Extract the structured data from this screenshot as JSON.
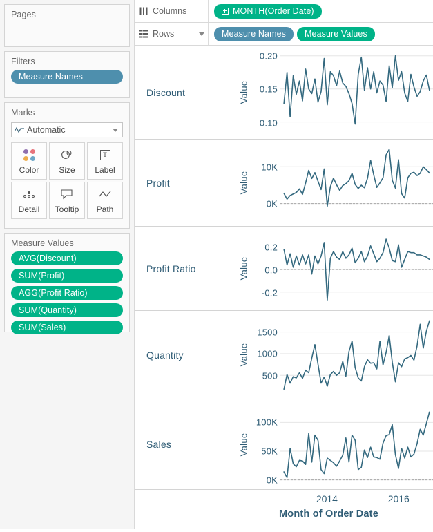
{
  "colors": {
    "pill_blue": "#4e8fad",
    "pill_green": "#00b388",
    "line": "#34697f",
    "text_blue": "#2f5c75",
    "panel_bg": "#f5f5f5",
    "card_bg": "#fafafa"
  },
  "left_panel": {
    "pages": {
      "title": "Pages"
    },
    "filters": {
      "title": "Filters",
      "pills": [
        {
          "label": "Measure Names",
          "color": "blue"
        }
      ]
    },
    "marks": {
      "title": "Marks",
      "mark_type": "Automatic",
      "mark_type_icon": "line-chart-icon",
      "buttons": [
        {
          "label": "Color",
          "icon": "color-dots-icon"
        },
        {
          "label": "Size",
          "icon": "size-icon"
        },
        {
          "label": "Label",
          "icon": "label-text-icon"
        },
        {
          "label": "Detail",
          "icon": "detail-dots-icon"
        },
        {
          "label": "Tooltip",
          "icon": "tooltip-icon"
        },
        {
          "label": "Path",
          "icon": "path-line-icon"
        }
      ]
    },
    "measure_values": {
      "title": "Measure Values",
      "pills": [
        {
          "label": "AVG(Discount)"
        },
        {
          "label": "SUM(Profit)"
        },
        {
          "label": "AGG(Profit Ratio)"
        },
        {
          "label": "SUM(Quantity)"
        },
        {
          "label": "SUM(Sales)"
        }
      ]
    }
  },
  "shelves": {
    "columns": {
      "label": "Columns",
      "icon": "columns-icon",
      "pills": [
        {
          "label": "MONTH(Order Date)",
          "color": "green",
          "has_plus": true
        }
      ]
    },
    "rows": {
      "label": "Rows",
      "icon": "rows-icon",
      "has_caret": true,
      "pills": [
        {
          "label": "Measure Names",
          "color": "blue",
          "has_plus": false
        },
        {
          "label": "Measure Values",
          "color": "green",
          "has_plus": false
        }
      ]
    }
  },
  "chart_data": {
    "type": "line",
    "title": "",
    "xlabel": "Month of Order Date",
    "ylabel": "Value",
    "grid": true,
    "legend": "none",
    "x_tick_labels": [
      "2014",
      "2016"
    ],
    "x_tick_positions": [
      0.305,
      0.775
    ],
    "x": [
      "2013-01",
      "2013-02",
      "2013-03",
      "2013-04",
      "2013-05",
      "2013-06",
      "2013-07",
      "2013-08",
      "2013-09",
      "2013-10",
      "2013-11",
      "2013-12",
      "2014-01",
      "2014-02",
      "2014-03",
      "2014-04",
      "2014-05",
      "2014-06",
      "2014-07",
      "2014-08",
      "2014-09",
      "2014-10",
      "2014-11",
      "2014-12",
      "2015-01",
      "2015-02",
      "2015-03",
      "2015-04",
      "2015-05",
      "2015-06",
      "2015-07",
      "2015-08",
      "2015-09",
      "2015-10",
      "2015-11",
      "2015-12",
      "2016-01",
      "2016-02",
      "2016-03",
      "2016-04",
      "2016-05",
      "2016-06",
      "2016-07",
      "2016-08",
      "2016-09",
      "2016-10",
      "2016-11",
      "2016-12"
    ],
    "panels": [
      {
        "name": "Discount",
        "measure": "AVG(Discount)",
        "ylabel": "Value",
        "ylim": [
          0.085,
          0.205
        ],
        "ticks": [
          {
            "value": 0.2,
            "label": "0.20"
          },
          {
            "value": 0.15,
            "label": "0.15"
          },
          {
            "value": 0.1,
            "label": "0.10"
          }
        ],
        "zero_line": null,
        "values": [
          0.128,
          0.175,
          0.108,
          0.17,
          0.142,
          0.162,
          0.132,
          0.18,
          0.15,
          0.143,
          0.165,
          0.13,
          0.146,
          0.196,
          0.126,
          0.176,
          0.17,
          0.155,
          0.177,
          0.159,
          0.154,
          0.143,
          0.128,
          0.097,
          0.172,
          0.198,
          0.148,
          0.182,
          0.15,
          0.176,
          0.144,
          0.162,
          0.156,
          0.131,
          0.185,
          0.152,
          0.2,
          0.163,
          0.176,
          0.144,
          0.131,
          0.172,
          0.153,
          0.139,
          0.146,
          0.162,
          0.171,
          0.148
        ]
      },
      {
        "name": "Profit",
        "measure": "SUM(Profit)",
        "ylabel": "Value",
        "ylim": [
          -4200,
          15500
        ],
        "ticks": [
          {
            "value": 10000,
            "label": "10K"
          },
          {
            "value": 0,
            "label": "0K"
          }
        ],
        "zero_line": 0,
        "values": [
          2800,
          1200,
          2200,
          2600,
          3000,
          4000,
          2500,
          5600,
          9000,
          6800,
          8400,
          6100,
          3800,
          9400,
          -700,
          4600,
          6900,
          5100,
          3600,
          4900,
          5400,
          6200,
          8200,
          5200,
          4100,
          5000,
          4300,
          6900,
          11700,
          7800,
          4400,
          5600,
          7000,
          13200,
          14700,
          6300,
          4200,
          11900,
          2700,
          1500,
          7000,
          8200,
          8500,
          7600,
          8200,
          10000,
          9200,
          8300
        ]
      },
      {
        "name": "Profit Ratio",
        "measure": "AGG(Profit Ratio)",
        "ylabel": "Value",
        "ylim": [
          -0.3,
          0.32
        ],
        "ticks": [
          {
            "value": 0.2,
            "label": "0.2"
          },
          {
            "value": 0.0,
            "label": "0.0"
          },
          {
            "value": -0.2,
            "label": "-0.2"
          }
        ],
        "zero_line": 0.0,
        "values": [
          0.18,
          0.04,
          0.14,
          0.02,
          0.12,
          0.04,
          0.13,
          0.05,
          0.13,
          -0.04,
          0.12,
          0.05,
          0.12,
          0.24,
          -0.27,
          0.1,
          0.16,
          0.11,
          0.09,
          0.16,
          0.1,
          0.13,
          0.19,
          0.06,
          0.1,
          0.16,
          0.07,
          0.12,
          0.21,
          0.14,
          0.07,
          0.1,
          0.15,
          0.27,
          0.19,
          0.08,
          0.07,
          0.22,
          0.02,
          0.09,
          0.16,
          0.15,
          0.15,
          0.13,
          0.13,
          0.12,
          0.11,
          0.09
        ]
      },
      {
        "name": "Quantity",
        "measure": "SUM(Quantity)",
        "ylabel": "Value",
        "ylim": [
          120,
          1830
        ],
        "ticks": [
          {
            "value": 1500,
            "label": "1500"
          },
          {
            "value": 1000,
            "label": "1000"
          },
          {
            "value": 500,
            "label": "500"
          }
        ],
        "zero_line": null,
        "values": [
          180,
          520,
          320,
          470,
          440,
          560,
          430,
          620,
          560,
          900,
          1210,
          760,
          320,
          460,
          250,
          520,
          590,
          500,
          560,
          820,
          480,
          1050,
          1290,
          680,
          440,
          370,
          700,
          860,
          780,
          790,
          650,
          1290,
          740,
          1030,
          1420,
          800,
          350,
          790,
          700,
          880,
          910,
          960,
          850,
          1180,
          1680,
          1130,
          1520,
          1760
        ]
      },
      {
        "name": "Sales",
        "measure": "SUM(Sales)",
        "ylabel": "Value",
        "ylim": [
          -4000,
          128000
        ],
        "ticks": [
          {
            "value": 100000,
            "label": "100K"
          },
          {
            "value": 50000,
            "label": "50K"
          },
          {
            "value": 0,
            "label": "0K"
          }
        ],
        "zero_line": 0,
        "values": [
          14000,
          4000,
          55000,
          28000,
          23000,
          34000,
          33000,
          27000,
          81000,
          31000,
          78000,
          69000,
          18000,
          11000,
          38000,
          34000,
          30000,
          24000,
          33000,
          43000,
          73000,
          31000,
          78000,
          69000,
          18000,
          22000,
          52000,
          39000,
          57000,
          40000,
          39000,
          36000,
          64000,
          77000,
          79000,
          96000,
          44000,
          20000,
          55000,
          38000,
          57000,
          40000,
          45000,
          63000,
          88000,
          78000,
          98000,
          118000
        ]
      }
    ]
  }
}
